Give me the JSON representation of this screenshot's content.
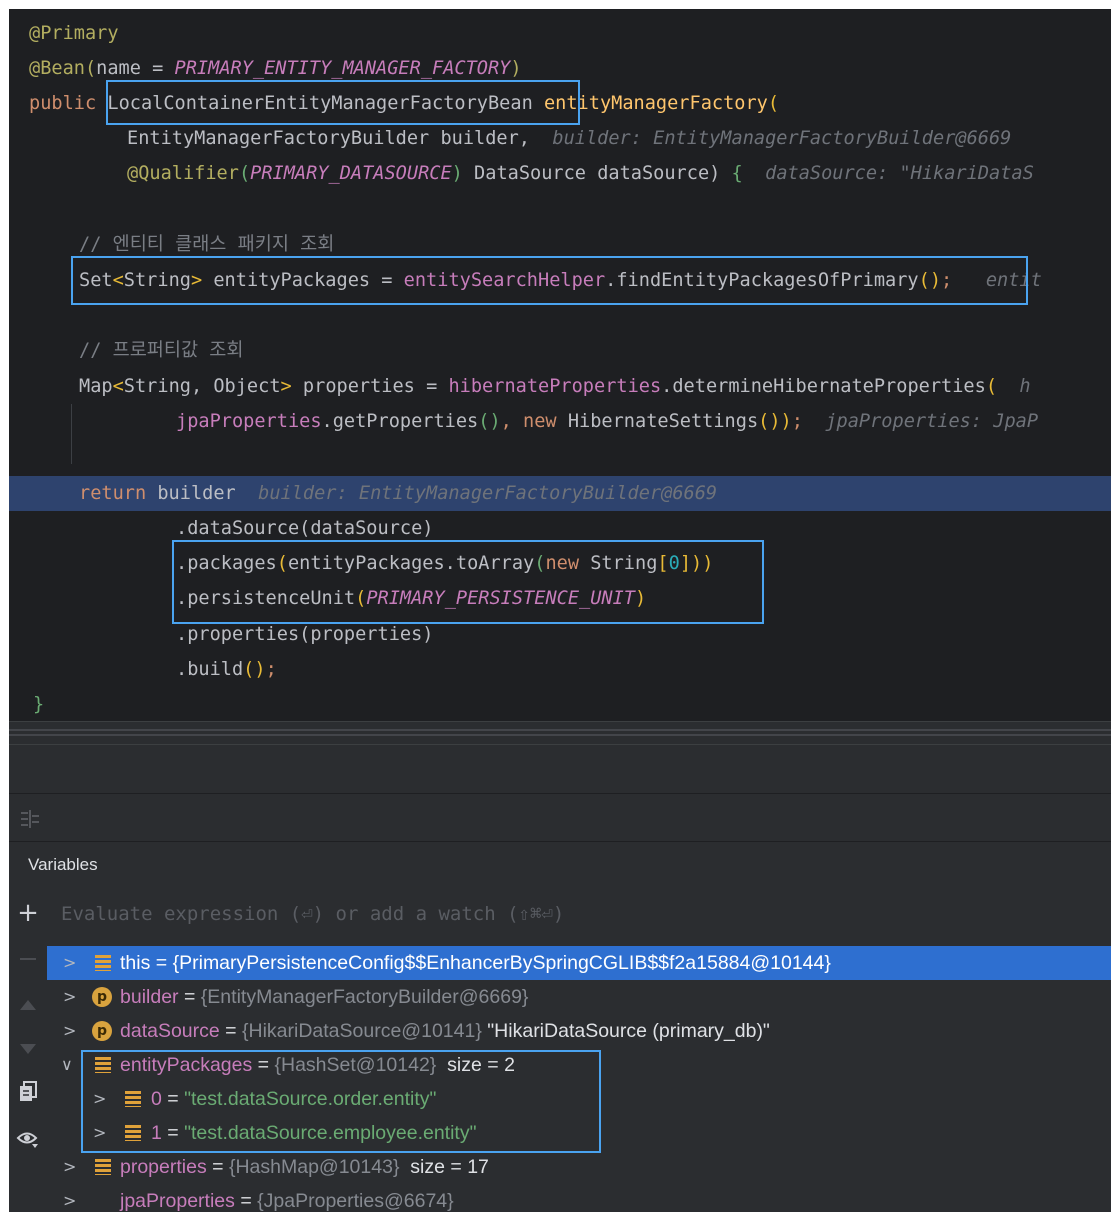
{
  "editor": {
    "lines": {
      "l1_annot": "@Primary",
      "l2_annot": "@Bean(",
      "l2_name": "name = ",
      "l2_const": "PRIMARY_ENTITY_MANAGER_FACTORY",
      "l2_close": ")",
      "l3_public": "public",
      "l3_type": "LocalContainerEntityManagerFactoryBean",
      "l3_method": "entityManagerFactory",
      "l3_paren": "(",
      "l4_param": "EntityManagerFactoryBuilder builder,",
      "l4_hint": "builder: EntityManagerFactoryBuilder@6669",
      "l5_annot": "@Qualifier",
      "l5_open": "(",
      "l5_const": "PRIMARY_DATASOURCE",
      "l5_close": ")",
      "l5_param": " DataSource dataSource) ",
      "l5_brace": "{",
      "l5_hint": "dataSource: \"HikariDataS",
      "l7_comment": "// 엔티티 클래스 패키지 조회",
      "l8_set": "Set",
      "l8_lt": "<",
      "l8_string": "String",
      "l8_gt": ">",
      "l8_var": " entityPackages = ",
      "l8_field": "entitySearchHelper",
      "l8_call": ".findEntityPackagesOfPrimary",
      "l8_parens": "()",
      "l8_semi": ";",
      "l8_hint": "entit",
      "l10_comment": "// 프로퍼티값 조회",
      "l11_map": "Map",
      "l11_lt": "<",
      "l11_types": "String, Object",
      "l11_gt": ">",
      "l11_var": " properties = ",
      "l11_field": "hibernateProperties",
      "l11_call": ".determineHibernateProperties",
      "l11_paren": "(",
      "l11_hint": "h",
      "l12_field": "jpaProperties",
      "l12_call": ".getProperties",
      "l12_parens": "()",
      "l12_comma": ", ",
      "l12_new": "new",
      "l12_cls": " HibernateSettings",
      "l12_parens2": "())",
      "l12_semi": ";",
      "l12_hint": "jpaProperties: JpaP",
      "l14_return": "return",
      "l14_builder": " builder",
      "l14_hint": "builder: EntityManagerFactoryBuilder@6669",
      "l15_call": ".dataSource",
      "l15_args": "(dataSource)",
      "l16_call": ".packages",
      "l16_open": "(",
      "l16_mid": "entityPackages.toArray",
      "l16_open2": "(",
      "l16_new": "new",
      "l16_cls": " String",
      "l16_lb": "[",
      "l16_zero": "0",
      "l16_rb": "]",
      "l16_close": "))",
      "l17_call": ".persistenceUnit",
      "l17_open": "(",
      "l17_const": "PRIMARY_PERSISTENCE_UNIT",
      "l17_close": ")",
      "l18_call": ".properties",
      "l18_args": "(properties)",
      "l19_call": ".build",
      "l19_parens": "()",
      "l19_semi": ";",
      "l20_brace": "}"
    }
  },
  "debug": {
    "panel_title": "Variables",
    "evaluate_placeholder": "Evaluate expression (⏎) or add a watch (⇧⌘⏎)",
    "layout_icon": "layout-icon",
    "side_tools": [
      "add-icon",
      "remove-icon",
      "move-up-icon",
      "move-down-icon",
      "copy-icon",
      "watch-icon"
    ],
    "variables": [
      {
        "name": "this",
        "eq": " = ",
        "ref": "{PrimaryPersistenceConfig$$EnhancerBySpringCGLIB$$f2a15884@10144}",
        "extra": "",
        "icon": "list-icon",
        "expanded": false,
        "selected": true
      },
      {
        "name": "builder",
        "eq": " = ",
        "ref": "{EntityManagerFactoryBuilder@6669}",
        "extra": "",
        "icon": "parameter-icon",
        "expanded": false,
        "selected": false
      },
      {
        "name": "dataSource",
        "eq": " = ",
        "ref": "{HikariDataSource@10141}",
        "extra": " \"HikariDataSource (primary_db)\"",
        "icon": "parameter-icon",
        "expanded": false,
        "selected": false
      },
      {
        "name": "entityPackages",
        "eq": " = ",
        "ref": "{HashSet@10142}",
        "extra": "  size = 2",
        "icon": "list-icon",
        "expanded": true,
        "selected": false
      },
      {
        "name": "0",
        "eq": " = ",
        "value": "\"test.dataSource.order.entity\"",
        "icon": "list-icon",
        "child": true
      },
      {
        "name": "1",
        "eq": " = ",
        "value": "\"test.dataSource.employee.entity\"",
        "icon": "list-icon",
        "child": true
      },
      {
        "name": "properties",
        "eq": " = ",
        "ref": "{HashMap@10143}",
        "extra": "  size = 17",
        "icon": "list-icon",
        "expanded": false,
        "selected": false
      },
      {
        "name": "jpaProperties",
        "eq": " = ",
        "ref": "{JpaProperties@6674}",
        "extra": "",
        "icon": "glasses-icon",
        "expanded": false,
        "selected": false
      }
    ]
  },
  "colors": {
    "editor_bg": "#1e1f22",
    "panel_bg": "#2b2d30",
    "highlight_box": "#4aa3f0",
    "exec_line": "#2e436e",
    "selection": "#2e6fd0"
  }
}
